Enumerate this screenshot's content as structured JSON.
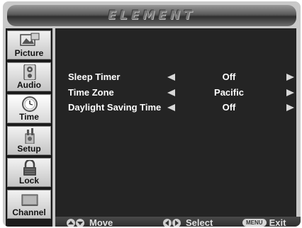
{
  "header": {
    "brand": "ELEMENT"
  },
  "sidebar": {
    "items": [
      {
        "label": "Picture",
        "icon": "picture-icon"
      },
      {
        "label": "Audio",
        "icon": "speaker-icon"
      },
      {
        "label": "Time",
        "icon": "clock-icon"
      },
      {
        "label": "Setup",
        "icon": "wrench-icon"
      },
      {
        "label": "Lock",
        "icon": "lock-icon"
      },
      {
        "label": "Channel",
        "icon": "antenna-icon"
      }
    ],
    "selected": "Time"
  },
  "settings": [
    {
      "label": "Sleep Timer",
      "value": "Off"
    },
    {
      "label": "Time Zone",
      "value": "Pacific"
    },
    {
      "label": "Daylight Saving Time",
      "value": "Off"
    }
  ],
  "footer": {
    "move_label": "Move",
    "select_label": "Select",
    "menu_key": "MENU",
    "exit_label": "Exit"
  },
  "colors": {
    "panel_background": "#242424",
    "sidebar_background": "#1c1c1c",
    "text": "#ffffff"
  }
}
